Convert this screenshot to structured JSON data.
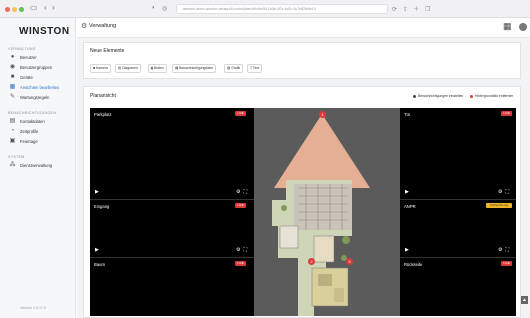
{
  "browser": {
    "url": "wieland-demo.winston.de/app/#/control/plan/a9c6e0f4-1b3a-4f7e-bd2c-5c7e82fd9e14"
  },
  "app": {
    "logo": "WINSTON",
    "page_title": "Verwaltung"
  },
  "sidebar": {
    "sections": [
      {
        "label": "VERWALTUNG",
        "items": [
          {
            "label": "Benutzer",
            "icon": "user-icon"
          },
          {
            "label": "Benutzergruppen",
            "icon": "users-icon"
          },
          {
            "label": "Geräte",
            "icon": "camera-icon"
          },
          {
            "label": "Ansichten bearbeiten",
            "icon": "layout-icon",
            "active": true
          },
          {
            "label": "Wartungsregeln",
            "icon": "wrench-icon"
          }
        ]
      },
      {
        "label": "BENACHRICHTIGUNGEN",
        "items": [
          {
            "label": "Kontaktdaten",
            "icon": "contacts-icon"
          },
          {
            "label": "Zeitprofile",
            "icon": "clock-icon"
          },
          {
            "label": "Feiertage",
            "icon": "calendar-icon"
          }
        ]
      },
      {
        "label": "SYSTEM",
        "items": [
          {
            "label": "Dienstverwaltung",
            "icon": "network-icon"
          }
        ]
      }
    ],
    "version": "Version 1.9.17.0"
  },
  "new_elements": {
    "title": "Neue Elemente",
    "buttons": [
      "Kamera",
      "Diagramm",
      "Button",
      "Benachrichtigungsliste",
      "Grafik",
      "Text"
    ]
  },
  "planview": {
    "title": "Planansicht",
    "actions": [
      {
        "label": "Benachrichtigungen einstellen",
        "color": "#4a4a4a"
      },
      {
        "label": "Hintergrundbild entfernen",
        "color": "#d93a3a"
      }
    ],
    "cameras": [
      {
        "name": "Parkplatz",
        "status": "LIVE"
      },
      {
        "name": "Eingang",
        "status": "LIVE"
      },
      {
        "name": "Baum",
        "status": "LIVE"
      },
      {
        "name": "Tür",
        "status": "LIVE"
      },
      {
        "name": "ANPR",
        "status": "Aufzeichnung"
      },
      {
        "name": "Rückseite",
        "status": "LIVE"
      }
    ],
    "markers": [
      "1",
      "2",
      "3"
    ]
  },
  "colors": {
    "accent": "#2a72c9",
    "live": "#d93a3a",
    "warning": "#f0b428",
    "cone": "#f4b89a"
  }
}
